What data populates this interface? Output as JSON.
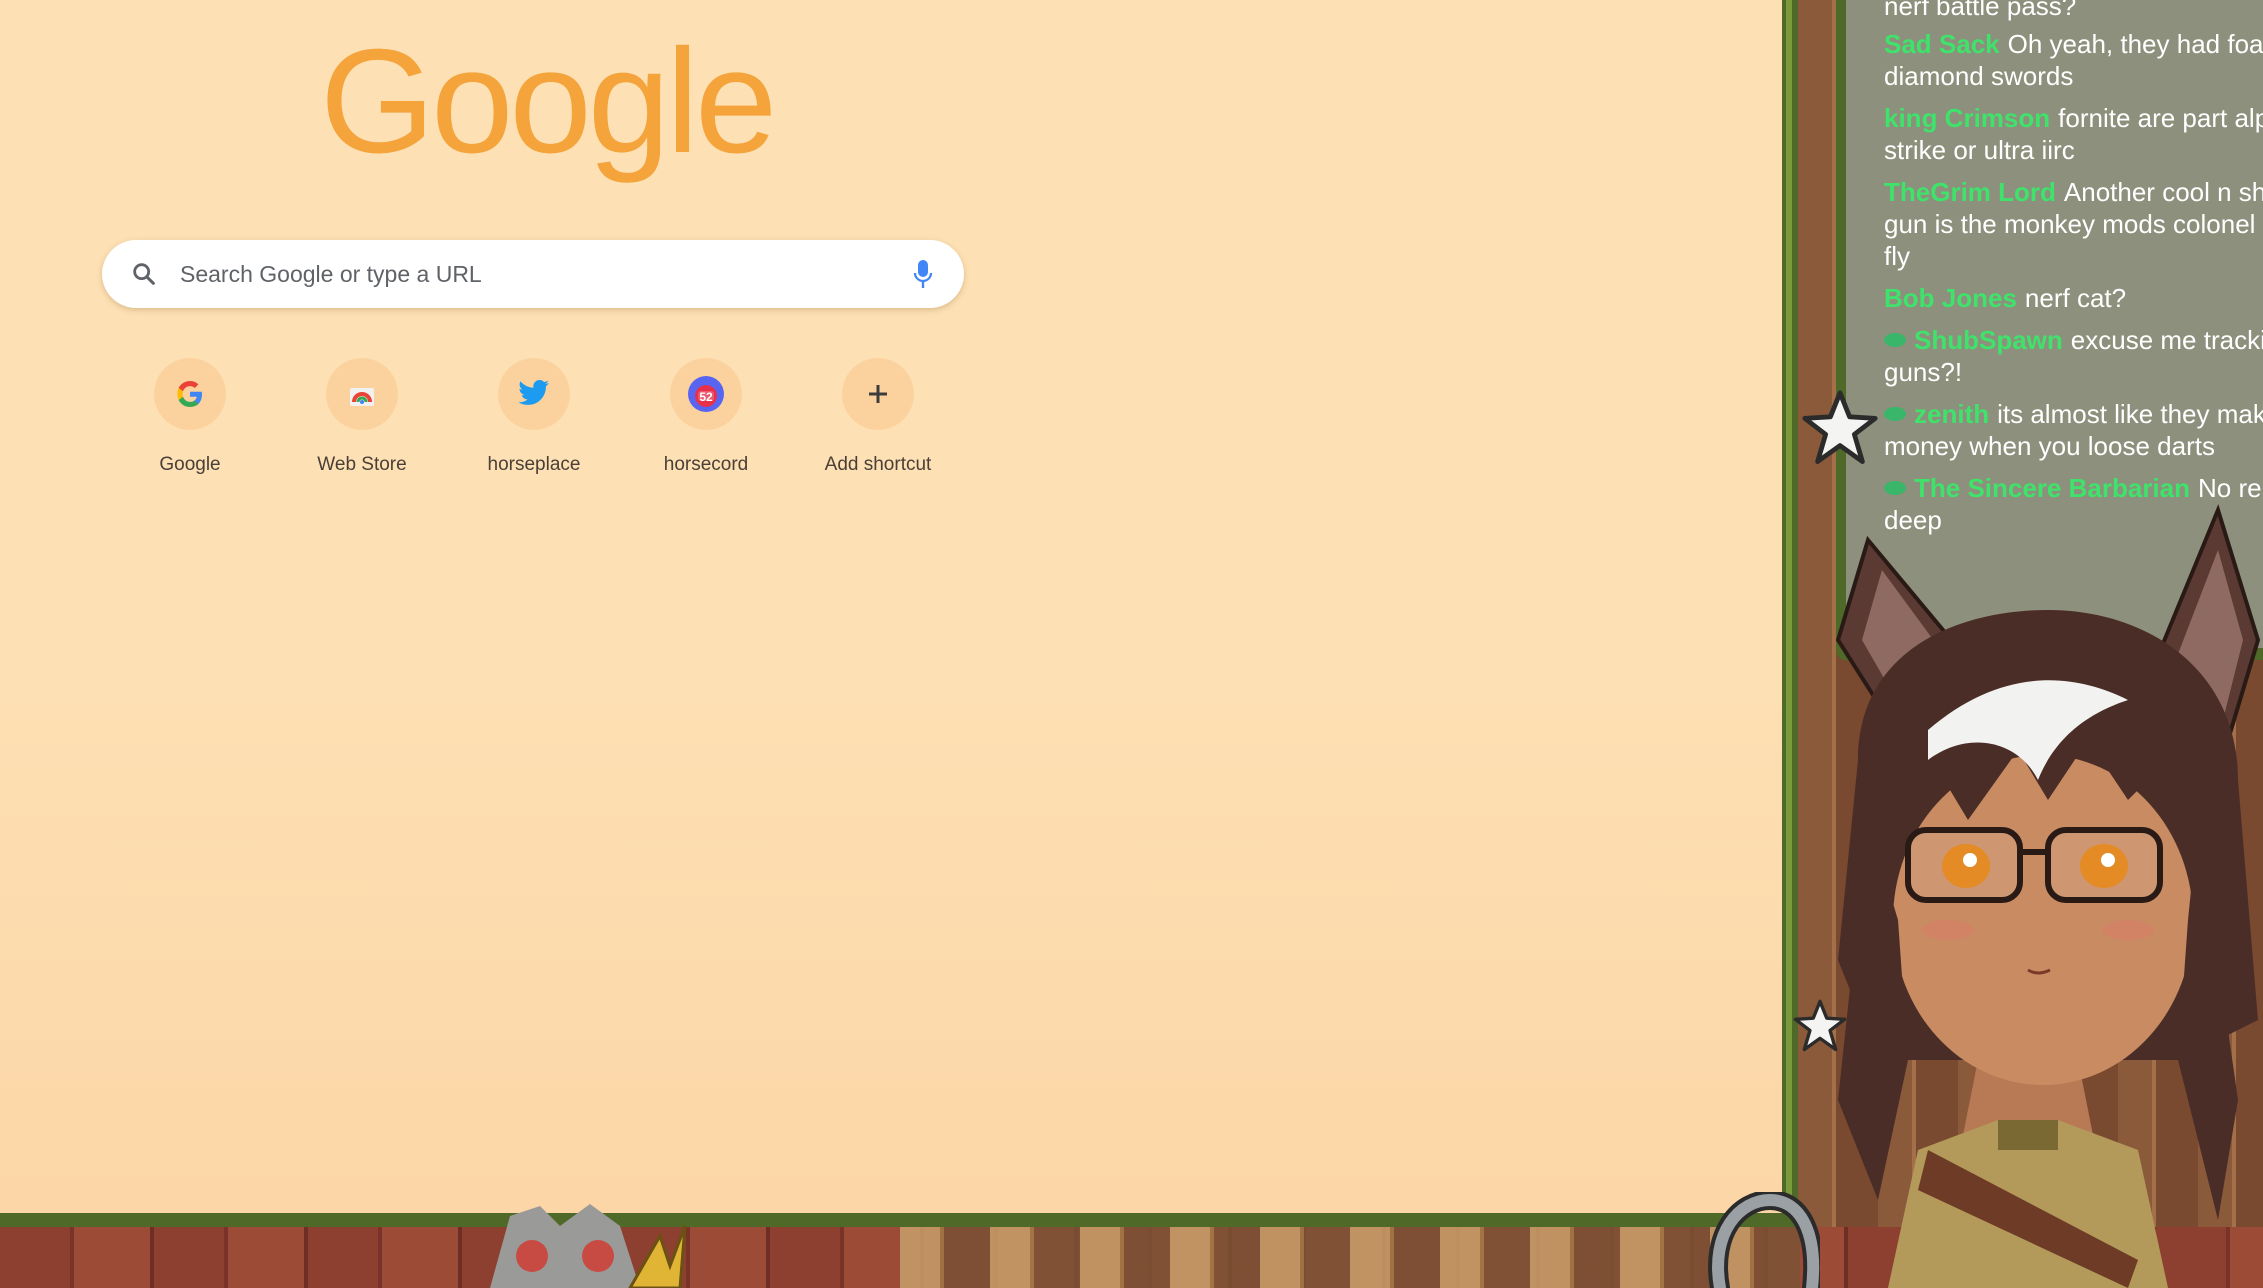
{
  "browser": {
    "logo_text": "Google",
    "search": {
      "placeholder": "Search Google or type a URL",
      "value": "",
      "left_icon": "search-icon",
      "right_icon": "microphone-icon"
    },
    "shortcuts": [
      {
        "label": "Google",
        "icon": "google-g-icon"
      },
      {
        "label": "Web Store",
        "icon": "web-store-icon"
      },
      {
        "label": "horseplace",
        "icon": "twitter-bird-icon"
      },
      {
        "label": "horsecord",
        "icon": "horsecord-icon"
      },
      {
        "label": "Add shortcut",
        "icon": "plus-icon"
      }
    ]
  },
  "chat": {
    "partial_top_line": "nerf battle pass?",
    "messages": [
      {
        "user": "Sad Sack",
        "text": "Oh yeah, they had foam diamond swords",
        "badge": false
      },
      {
        "user": "king Crimson",
        "text": "fornite are part alpha strike or ultra iirc",
        "badge": false
      },
      {
        "user": "TheGrim Lord",
        "text": "Another cool n shoot gun is the monkey mods colonel fire fly",
        "badge": false
      },
      {
        "user": "Bob Jones",
        "text": "nerf cat?",
        "badge": false
      },
      {
        "user": "ShubSpawn",
        "text": "excuse me tracking guns?!",
        "badge": true
      },
      {
        "user": "zenith",
        "text": "its almost like they make money when you loose darts",
        "badge": true
      },
      {
        "user": "The Sincere Barbarian",
        "text": "No re is deep",
        "badge": true
      }
    ]
  },
  "colors": {
    "page_bg": "#fde0b4",
    "logo": "#f4a43a",
    "frame_green": "#4f6a28",
    "chat_bg": "#8d907c",
    "chat_username": "#3fe26a"
  }
}
